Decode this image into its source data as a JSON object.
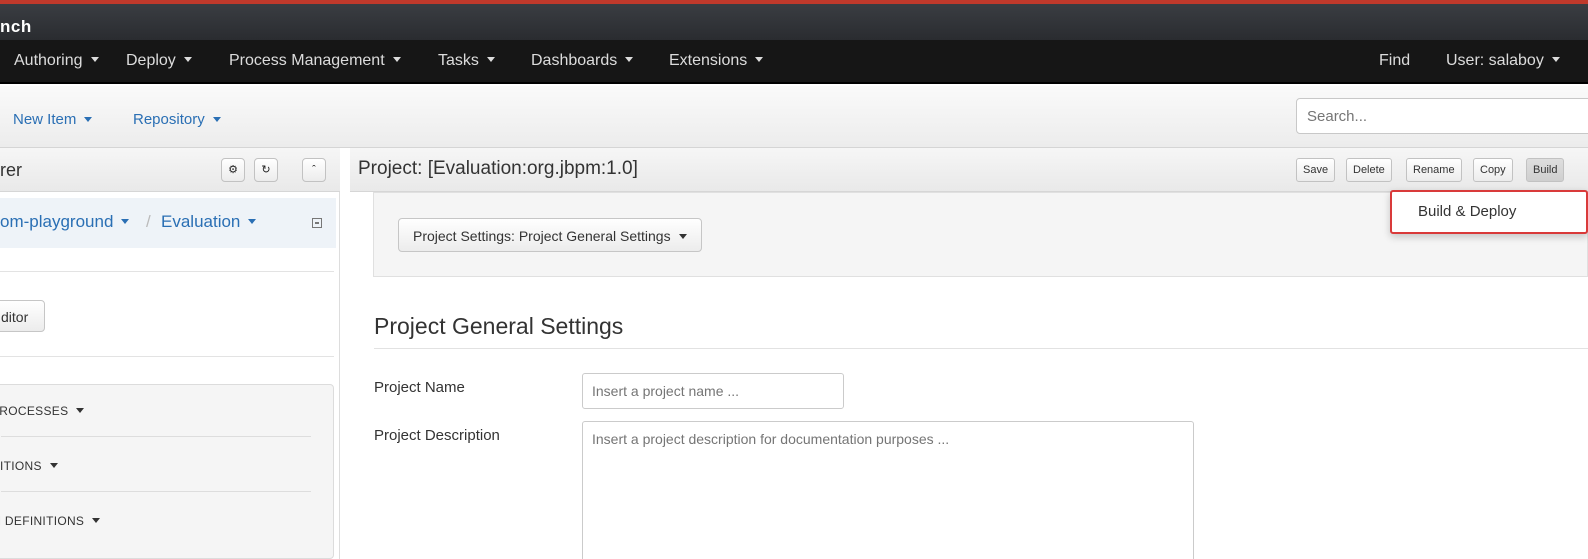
{
  "titlebar": {
    "title": "nch"
  },
  "mainnav": {
    "items": [
      {
        "label": "Authoring"
      },
      {
        "label": "Deploy"
      },
      {
        "label": "Process Management"
      },
      {
        "label": "Tasks"
      },
      {
        "label": "Dashboards"
      },
      {
        "label": "Extensions"
      }
    ],
    "find": "Find",
    "user": "User: salaboy"
  },
  "toolbar2": {
    "new_item": "New Item",
    "repository": "Repository",
    "search_placeholder": "Search..."
  },
  "leftpanel": {
    "title": "rer",
    "breadcrumb": {
      "repo": "om-playground",
      "separator": "/",
      "project": "Evaluation"
    },
    "editor_button": "ditor",
    "sections": [
      {
        "label": "PROCESSES"
      },
      {
        "label": "NITIONS"
      },
      {
        "label": "M DEFINITIONS"
      }
    ]
  },
  "rightpanel": {
    "title": "Project: [Evaluation:org.jbpm:1.0]",
    "actions": {
      "save": "Save",
      "delete": "Delete",
      "rename": "Rename",
      "copy": "Copy",
      "build": "Build"
    },
    "settings_dropdown": "Project Settings: Project General Settings",
    "page_title": "Project General Settings",
    "fields": {
      "name_label": "Project Name",
      "name_placeholder": "Insert a project name ...",
      "description_label": "Project Description",
      "description_placeholder": "Insert a project description for documentation purposes ..."
    }
  },
  "build_menu": {
    "build_and_deploy": "Build & Deploy"
  },
  "colors": {
    "accent_red": "#d93a3a",
    "link_blue": "#2a6fb4",
    "nav_bg": "#161616"
  }
}
